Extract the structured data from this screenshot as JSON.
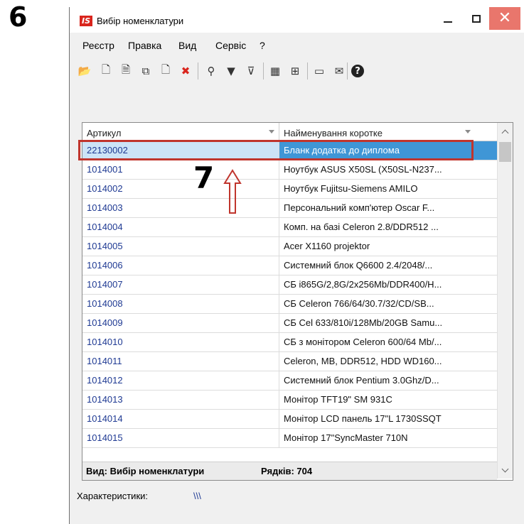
{
  "annotations": {
    "step_a": "6",
    "step_b": "7"
  },
  "window": {
    "logo": "IS",
    "title": "Вибір номенклатури",
    "close_glyph": "✕"
  },
  "menu": [
    "Реєстр",
    "Правка",
    "Вид",
    "Сервіс",
    "?"
  ],
  "toolbar": [
    {
      "icon": "open-folder-icon",
      "glyph": "📂"
    },
    {
      "icon": "new-document-icon",
      "glyph": "🗋"
    },
    {
      "icon": "edit-document-icon",
      "glyph": "🗎"
    },
    {
      "icon": "copy-icon",
      "glyph": "⧉"
    },
    {
      "icon": "delete-document-icon",
      "glyph": "🗋"
    },
    {
      "icon": "delete-x-icon",
      "glyph": "✖"
    },
    {
      "icon": "search-icon",
      "glyph": "⚲"
    },
    {
      "icon": "filter-icon",
      "glyph": "▼"
    },
    {
      "icon": "clear-filter-icon",
      "glyph": "⊽"
    },
    {
      "icon": "table-icon",
      "glyph": "▦"
    },
    {
      "icon": "tree-icon",
      "glyph": "⊞"
    },
    {
      "icon": "form-icon",
      "glyph": "▭"
    },
    {
      "icon": "mail-icon",
      "glyph": "✉"
    },
    {
      "icon": "help-icon",
      "glyph": "?"
    }
  ],
  "grid": {
    "columns": [
      "Артикул",
      "Найменування коротке"
    ],
    "rows": [
      {
        "code": "22130002",
        "name": "Бланк додатка до диплома",
        "selected": true
      },
      {
        "code": "1014001",
        "name": "Ноутбук ASUS X50SL (X50SL-N237..."
      },
      {
        "code": "1014002",
        "name": "Ноутбук Fujitsu-Siemens AMILO"
      },
      {
        "code": "1014003",
        "name": "Персональний комп'ютер Oscar F..."
      },
      {
        "code": "1014004",
        "name": "Комп. на базі Celeron 2.8/DDR512 ..."
      },
      {
        "code": "1014005",
        "name": "Acer X1160 projektor"
      },
      {
        "code": "1014006",
        "name": "Системний блок Q6600 2.4/2048/..."
      },
      {
        "code": "1014007",
        "name": "СБ i865G/2,8G/2x256Mb/DDR400/H..."
      },
      {
        "code": "1014008",
        "name": "СБ Celeron 766/64/30.7/32/CD/SB..."
      },
      {
        "code": "1014009",
        "name": "СБ Cel 633/810i/128Mb/20GB Samu..."
      },
      {
        "code": "1014010",
        "name": "СБ з монітором Celeron 600/64 Mb/..."
      },
      {
        "code": "1014011",
        "name": "Celeron, MB, DDR512, HDD WD160..."
      },
      {
        "code": "1014012",
        "name": "Системний блок Pentium 3.0Ghz/D..."
      },
      {
        "code": "1014013",
        "name": "Монітор TFT19\" SM 931C"
      },
      {
        "code": "1014014",
        "name": "Монітор LCD панель 17\"L 1730SSQT"
      },
      {
        "code": "1014015",
        "name": "Монітор 17\"SyncMaster 710N"
      }
    ],
    "footer": {
      "view": "Вид: Вибір номенклатури",
      "rows": "Рядків: 704"
    }
  },
  "characteristics": {
    "label": "Характеристики:",
    "value": "\\\\\\"
  },
  "colors": {
    "selection": "#3f96d6",
    "highlight": "#c0352d",
    "link_text": "#1f3a93",
    "close": "#e9766c"
  }
}
